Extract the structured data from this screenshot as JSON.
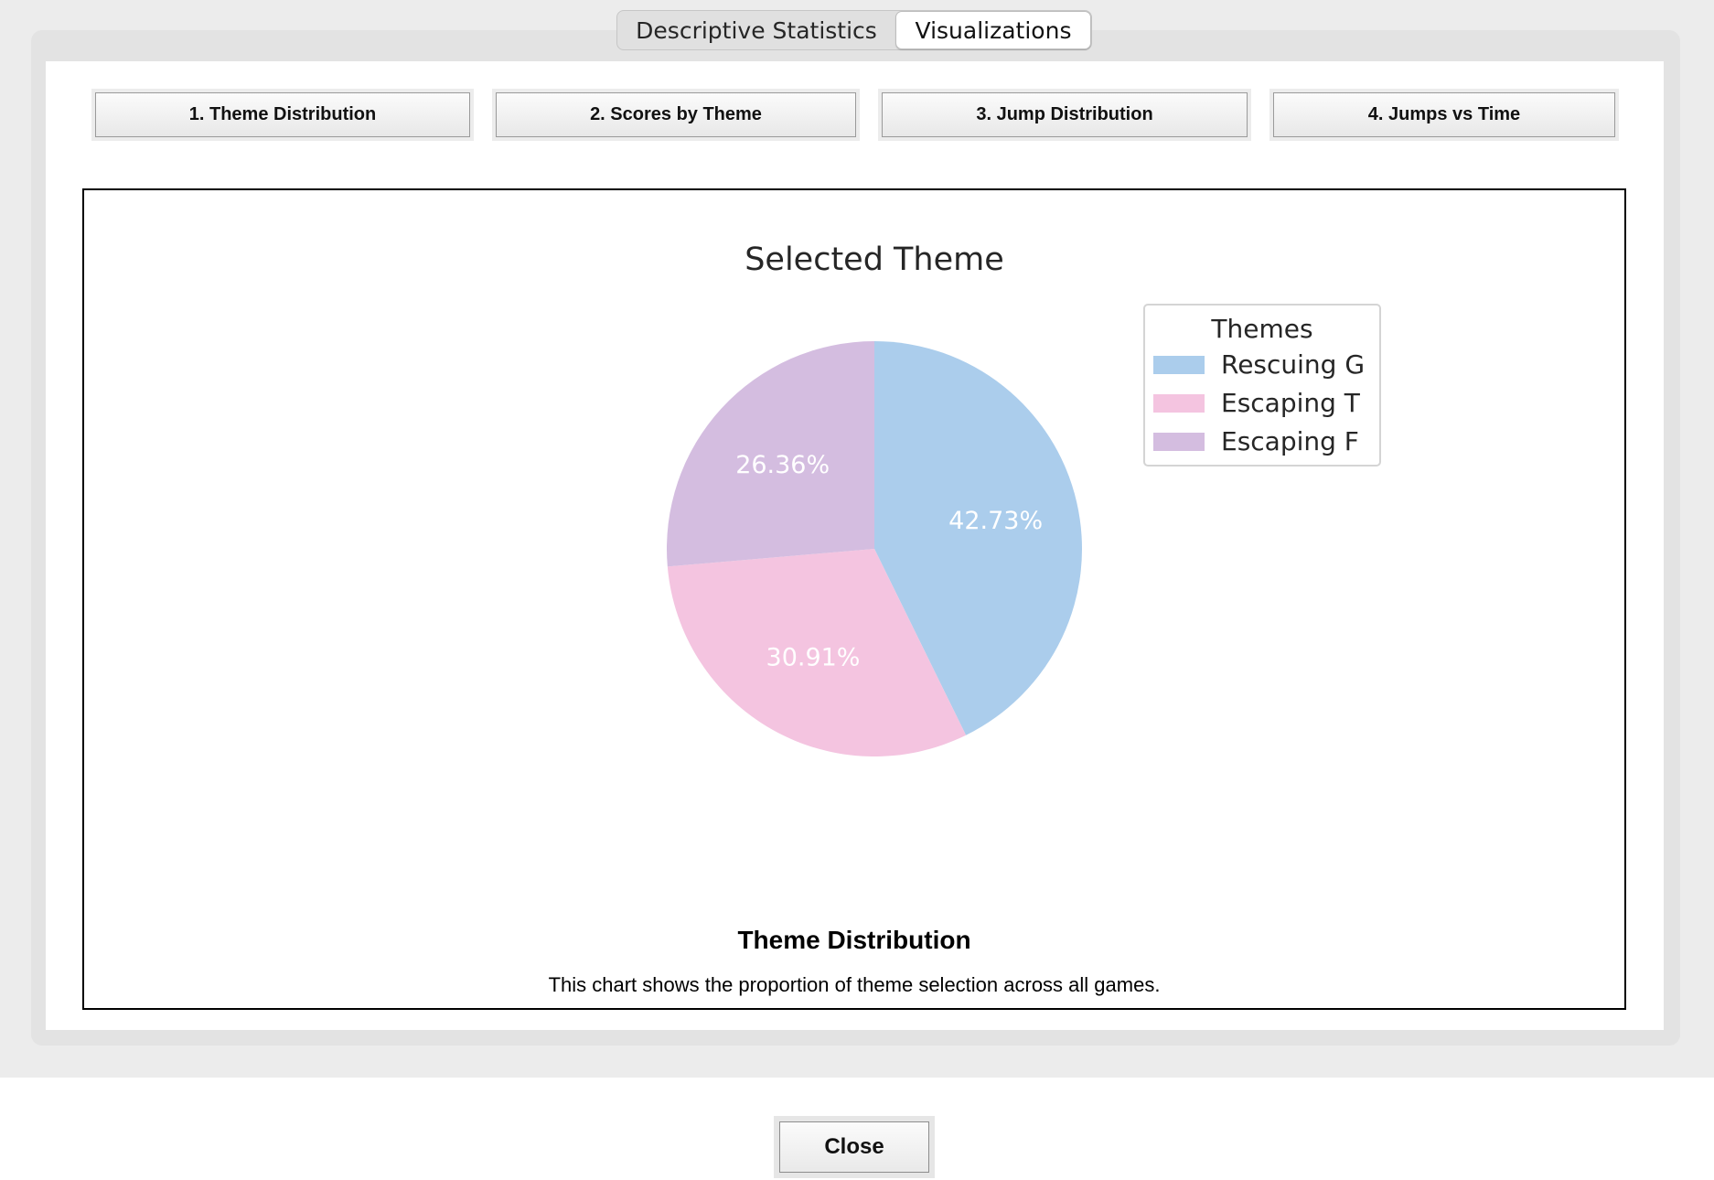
{
  "tabs": [
    {
      "label": "Descriptive Statistics",
      "active": false
    },
    {
      "label": "Visualizations",
      "active": true
    }
  ],
  "viz_buttons": [
    {
      "label": "1. Theme Distribution"
    },
    {
      "label": "2. Scores by Theme"
    },
    {
      "label": "3. Jump Distribution"
    },
    {
      "label": "4. Jumps vs Time"
    }
  ],
  "chart_data": {
    "type": "pie",
    "title": "Selected Theme",
    "categories": [
      "Rescuing G",
      "Escaping T",
      "Escaping F"
    ],
    "values": [
      42.73,
      30.91,
      26.36
    ],
    "labels": [
      "42.73%",
      "30.91%",
      "26.36%"
    ],
    "colors": [
      "#abcdec",
      "#f4c4e0",
      "#d4bde0"
    ],
    "legend": {
      "title": "Themes",
      "placement": "upper-right"
    },
    "start_angle": 90,
    "direction": "clockwise"
  },
  "caption": {
    "title": "Theme Distribution",
    "text": "This chart shows the proportion of theme selection across all games."
  },
  "close_label": "Close"
}
